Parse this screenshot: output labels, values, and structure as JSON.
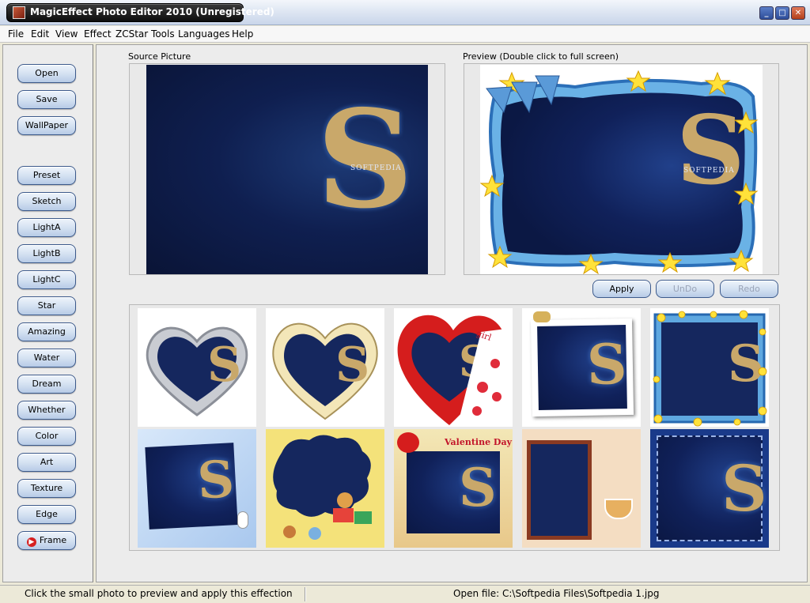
{
  "window": {
    "title": "MagicEffect Photo Editor 2010 (Unregistered)",
    "minimize": "_",
    "maximize": "□",
    "close": "✕"
  },
  "menu": [
    "File",
    "Edit",
    "View",
    "Effect",
    "ZCStar Tools",
    "Languages",
    "Help"
  ],
  "sidebar": {
    "group1": [
      "Open",
      "Save",
      "WallPaper"
    ],
    "group2": [
      "Preset",
      "Sketch",
      "LightA",
      "LightB",
      "LightC",
      "Star",
      "Amazing",
      "Water",
      "Dream",
      "Whether",
      "Color",
      "Art",
      "Texture",
      "Edge",
      "Frame"
    ]
  },
  "source": {
    "label": "Source Picture",
    "watermark": "SOFTPEDIA"
  },
  "preview": {
    "label": "Preview (Double click to full screen)",
    "watermark": "SOFTPEDIA"
  },
  "actions": {
    "apply": "Apply",
    "undo": "UnDo",
    "redo": "Redo"
  },
  "thumbs": [
    {
      "name": "silver-heart"
    },
    {
      "name": "cream-heart"
    },
    {
      "name": "red-heart-girl"
    },
    {
      "name": "ribbon-frame"
    },
    {
      "name": "star-frame"
    },
    {
      "name": "blue-snow-frame"
    },
    {
      "name": "toy-cloud-frame"
    },
    {
      "name": "valentine-day-frame"
    },
    {
      "name": "tea-cup-frame"
    },
    {
      "name": "stamp-frame"
    }
  ],
  "thumb_texts": {
    "valentine": "Valentine Day",
    "girl": "girl"
  },
  "status": {
    "left": "Click the small photo to preview and apply this effection",
    "right": "Open file: C:\\Softpedia Files\\Softpedia 1.jpg"
  }
}
